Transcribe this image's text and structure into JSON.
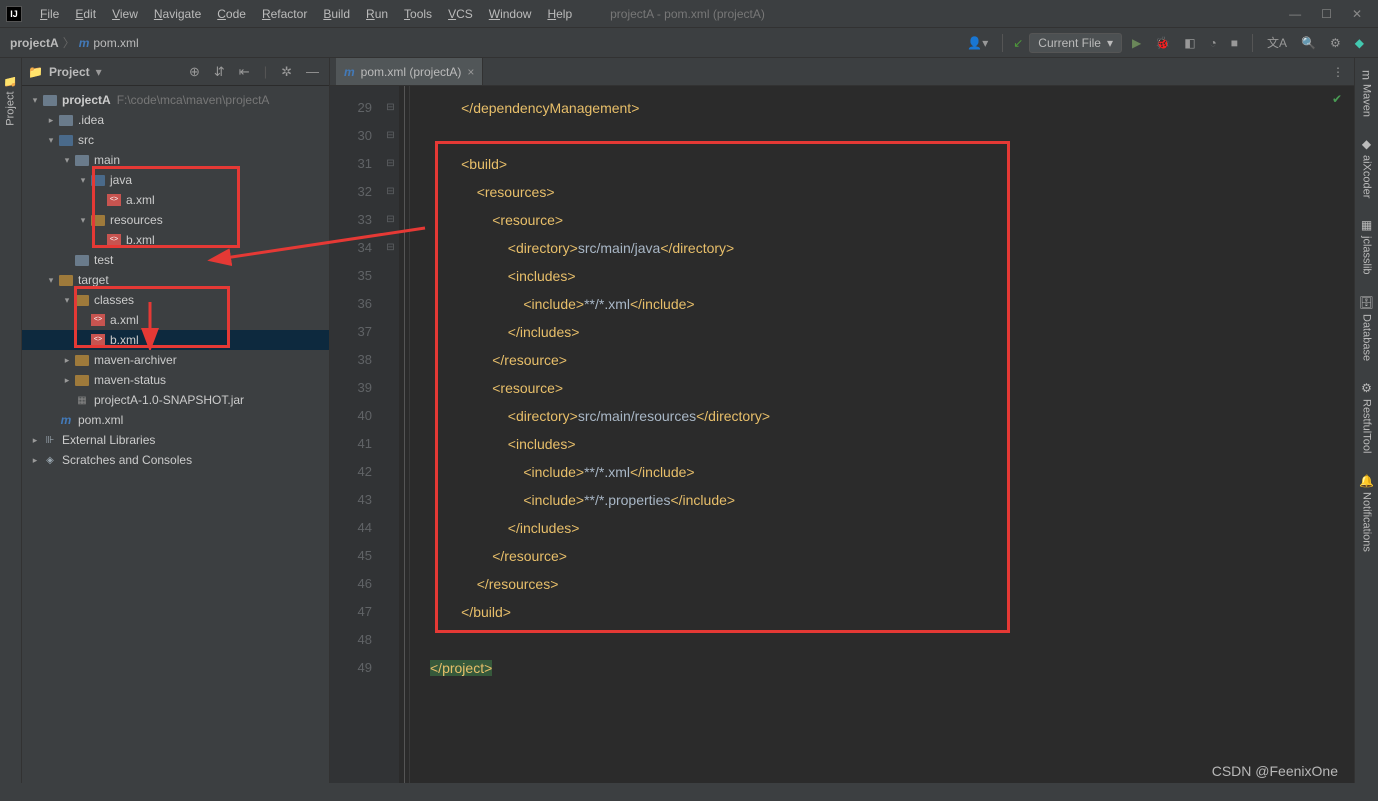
{
  "titlebar": {
    "menus": [
      "File",
      "Edit",
      "View",
      "Navigate",
      "Code",
      "Refactor",
      "Build",
      "Run",
      "Tools",
      "VCS",
      "Window",
      "Help"
    ],
    "title": "projectA - pom.xml (projectA)"
  },
  "breadcrumb": {
    "project": "projectA",
    "file": "pom.xml"
  },
  "toolbar": {
    "run_config": "Current File"
  },
  "project_panel": {
    "title": "Project"
  },
  "tree": {
    "root": "projectA",
    "root_hint": "F:\\code\\mca\\maven\\projectA",
    "idea": ".idea",
    "src": "src",
    "main": "main",
    "java": "java",
    "axml": "a.xml",
    "resources": "resources",
    "bxml": "b.xml",
    "test": "test",
    "target": "target",
    "classes": "classes",
    "classes_a": "a.xml",
    "classes_b": "b.xml",
    "maven_archiver": "maven-archiver",
    "maven_status": "maven-status",
    "jar": "projectA-1.0-SNAPSHOT.jar",
    "pom": "pom.xml",
    "ext_lib": "External Libraries",
    "scratches": "Scratches and Consoles"
  },
  "editor": {
    "tab_label": "pom.xml (projectA)",
    "line_start": 29,
    "lines": [
      {
        "indent": 2,
        "open": "</dependencyManagement>"
      },
      {
        "blank": true
      },
      {
        "indent": 2,
        "open": "<build>"
      },
      {
        "indent": 3,
        "open": "<resources>"
      },
      {
        "indent": 4,
        "open": "<resource>"
      },
      {
        "indent": 5,
        "open": "<directory>",
        "text": "src/main/java",
        "close": "</directory>"
      },
      {
        "indent": 5,
        "open": "<includes>"
      },
      {
        "indent": 6,
        "open": "<include>",
        "text": "**/*.xml",
        "close": "</include>"
      },
      {
        "indent": 5,
        "open": "</includes>"
      },
      {
        "indent": 4,
        "open": "</resource>"
      },
      {
        "indent": 4,
        "open": "<resource>"
      },
      {
        "indent": 5,
        "open": "<directory>",
        "text": "src/main/resources",
        "close": "</directory>"
      },
      {
        "indent": 5,
        "open": "<includes>"
      },
      {
        "indent": 6,
        "open": "<include>",
        "text": "**/*.xml",
        "close": "</include>"
      },
      {
        "indent": 6,
        "open": "<include>",
        "text": "**/*.properties",
        "close": "</include>"
      },
      {
        "indent": 5,
        "open": "</includes>"
      },
      {
        "indent": 4,
        "open": "</resource>"
      },
      {
        "indent": 3,
        "open": "</resources>"
      },
      {
        "indent": 2,
        "open": "</build>"
      },
      {
        "blank": true
      },
      {
        "indent": 0,
        "open": "</project>",
        "hl": true
      }
    ]
  },
  "right_tools": [
    "Maven",
    "aiXcoder",
    "jclasslib",
    "Database",
    "RestfulTool",
    "Notifications"
  ],
  "watermark": "CSDN @FeenixOne"
}
